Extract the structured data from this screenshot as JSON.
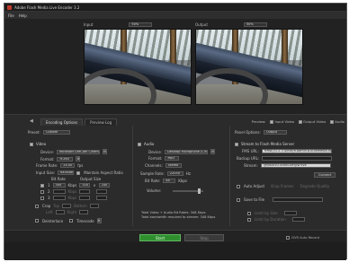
{
  "window": {
    "title": "Adobe Flash Media Live Encoder 3.2"
  },
  "menu": {
    "items": [
      "File",
      "Help"
    ]
  },
  "preview": {
    "input_label": "Input",
    "input_zoom": "50%",
    "output_label": "Output",
    "output_zoom": "50%"
  },
  "tabs": {
    "encoding": "Encoding Options",
    "preview": "Preview Log"
  },
  "preview_opts": {
    "label": "Preview:",
    "input_video": "Input Video",
    "output_video": "Output Video",
    "audio": "Audio"
  },
  "left": {
    "preset_label": "Preset:",
    "preset_value": "Custom",
    "video": {
      "title": "Video",
      "device_label": "Device:",
      "device_value": "Microsoft LifeCam Cinema",
      "format_label": "Format:",
      "format_value": "H.264",
      "frame_rate_label": "Frame Rate:",
      "frame_rate_value": "24.00",
      "fps": "fps",
      "input_size_label": "Input Size:",
      "input_size_value": "640x480",
      "maintain_aspect": "Maintain Aspect Ratio",
      "bitrate_col": "Bit Rate",
      "output_size_col": "Output Size",
      "rows": [
        {
          "num": "1",
          "bitrate": "300",
          "unit": "Kbps",
          "w": "320",
          "h": "240"
        },
        {
          "num": "2",
          "bitrate": "",
          "unit": "Kbps",
          "w": "",
          "h": ""
        },
        {
          "num": "3",
          "bitrate": "",
          "unit": "Kbps",
          "w": "",
          "h": ""
        }
      ],
      "crop_label": "Crop",
      "top_label": "Top",
      "bottom_label": "Bottom",
      "left_label": "Left",
      "right_label": "Right",
      "deinterlace_label": "Deinterlace",
      "timecode_label": "Timecode"
    }
  },
  "middle": {
    "audio": {
      "title": "Audio",
      "device_label": "Device:",
      "device_value": "Desktop Microphone (Cinema",
      "format_label": "Format:",
      "format_value": "Mp3",
      "channels_label": "Channels:",
      "channels_value": "Stereo",
      "sample_rate_label": "Sample Rate:",
      "sample_rate_value": "22050",
      "hz": "Hz",
      "bitrate_label": "Bit Rate:",
      "bitrate_value": "48",
      "kbps": "Kbps",
      "volume_label": "Volume:"
    },
    "totals": {
      "line1": "Total Video + Audio Bit Rates:  348 Kbps",
      "line2": "Total bandwidth required to stream:  348 Kbps"
    }
  },
  "right": {
    "panel_options_label": "Panel Options:",
    "panel_options_value": "Output",
    "stream_title": "Stream to Flash Media Server",
    "fms_url_label": "FMS URL:",
    "fms_url_value": "rtmp://1.2.3.4/live/a.admin.b.bulkmedia.net",
    "backup_url_label": "Backup URL:",
    "stream_label": "Stream:",
    "stream_value": "@fpsvcv3.StartLive@$Flive",
    "connect_label": "Connect",
    "auto_adjust_label": "Auto Adjust",
    "drop_frames": "Drop Frames",
    "degrade_quality": "Degrade Quality",
    "save_to_file_label": "Save to File",
    "limit_size_label": "Limit by Size",
    "limit_duration_label": "Limit by Duration"
  },
  "bottom": {
    "start_label": "Start",
    "stop_label": "Stop",
    "dvr_label": "DVR Auto Record"
  }
}
